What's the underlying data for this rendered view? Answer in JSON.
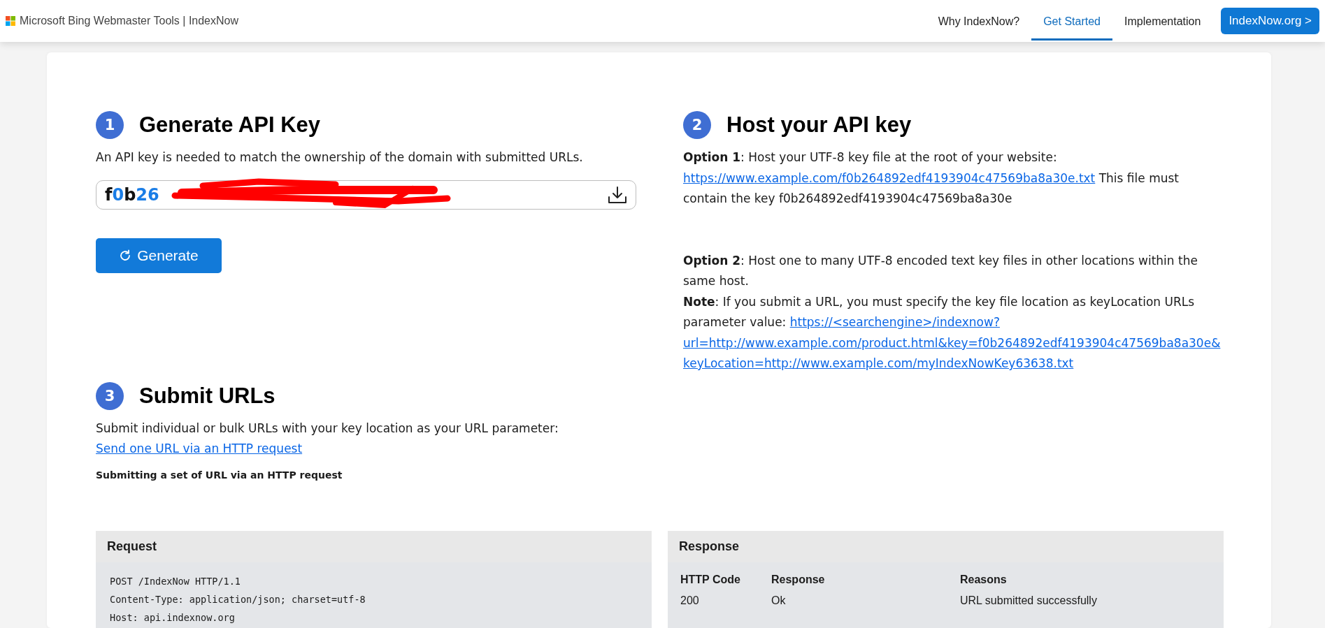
{
  "header": {
    "brand": "Microsoft Bing Webmaster Tools | IndexNow",
    "nav": [
      {
        "label": "Why IndexNow?",
        "selected": false
      },
      {
        "label": "Get Started",
        "selected": true
      },
      {
        "label": "Implementation",
        "selected": false
      }
    ],
    "cta": "IndexNow.org >"
  },
  "step1": {
    "number": "1",
    "title": "Generate API Key",
    "description": "An API key is needed to match the ownership of the domain with submitted URLs.",
    "key_value": "f0b26",
    "button": "Generate"
  },
  "step2": {
    "number": "2",
    "title": "Host your API key",
    "blocks": [
      [
        {
          "parts": [
            {
              "kind": "text",
              "text": "**Option 1**: Host your UTF-8 key file at the root of your website: "
            },
            {
              "kind": "link",
              "text": "https://www.example.com/f0b264892edf4193904c47569ba8a30e.txt"
            },
            {
              "kind": "text",
              "text": " This file must contain the key f0b264892edf4193904c47569ba8a30e"
            }
          ]
        }
      ],
      [
        {
          "parts": [
            {
              "kind": "text",
              "text": "**Option 2**: Host one to many UTF-8 encoded text key files in other locations within the same host."
            }
          ]
        },
        {
          "parts": [
            {
              "kind": "text",
              "text": "**Note**: If you submit a URL, you must specify the key file location as keyLocation URLs parameter value: "
            },
            {
              "kind": "link",
              "text": "https://<searchengine>/indexnow?"
            },
            {
              "kind": "link",
              "text": "url=http://www.example.com/product.html&key=f0b264892edf4193904c47569ba8a30e&"
            },
            {
              "kind": "link",
              "text": "keyLocation=http://www.example.com/myIndexNowKey63638.txt"
            }
          ]
        }
      ]
    ]
  },
  "step3": {
    "number": "3",
    "title": "Submit URLs",
    "parts": [
      {
        "kind": "text",
        "text": "Submit individual or bulk URLs with your key location as your URL parameter: "
      },
      {
        "kind": "link",
        "text": "Send one URL via an HTTP request"
      }
    ],
    "subheading": "Submitting a set of URL via an HTTP request"
  },
  "request": {
    "title": "Request",
    "lines": [
      "POST /IndexNow HTTP/1.1",
      "Content-Type: application/json; charset=utf-8",
      "Host: api.indexnow.org"
    ]
  },
  "response": {
    "title": "Response",
    "columns": [
      "HTTP Code",
      "Response",
      "Reasons"
    ],
    "rows": [
      [
        "200",
        "Ok",
        "URL submitted successfully"
      ]
    ]
  }
}
